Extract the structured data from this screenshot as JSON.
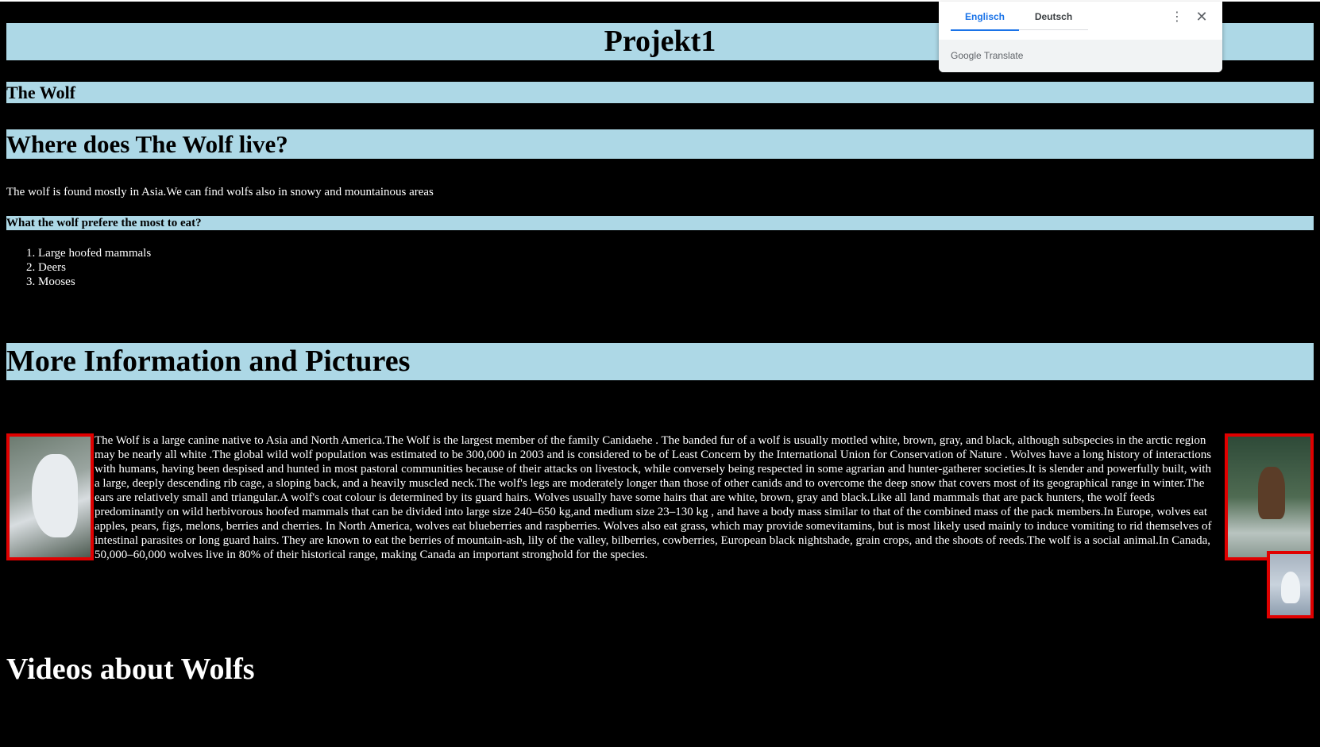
{
  "page": {
    "title": "Projekt1",
    "subtitle": "The Wolf",
    "where_heading": "Where does The Wolf live?",
    "where_text": "The wolf is found mostly in Asia.We can find wolfs also in snowy and mountainous areas",
    "eat_heading": "What the wolf prefere the most to eat?",
    "food_list": [
      "Large hoofed mammals",
      "Deers",
      "Mooses"
    ],
    "more_heading": "More Information and Pictures",
    "info_text": "The Wolf is a large canine native to Asia and North America.The Wolf is the largest member of the family Canidaehe . The banded fur of a wolf is usually mottled white, brown, gray, and black, although subspecies in the arctic region may be nearly all white .The global wild wolf population was estimated to be 300,000 in 2003 and is considered to be of Least Concern by the International Union for Conservation of Nature . Wolves have a long history of interactions with humans, having been despised and hunted in most pastoral communities because of their attacks on livestock, while conversely being respected in some agrarian and hunter-gatherer societies.It is slender and powerfully built, with a large, deeply descending rib cage, a sloping back, and a heavily muscled neck.The wolf's legs are moderately longer than those of other canids and to overcome the deep snow that covers most of its geographical range in winter.The ears are relatively small and triangular.A wolf's coat colour is determined by its guard hairs. Wolves usually have some hairs that are white, brown, gray and black.Like all land mammals that are pack hunters, the wolf feeds predominantly on wild herbivorous hoofed mammals that can be divided into large size 240–650 kg,and medium size 23–130 kg , and have a body mass similar to that of the combined mass of the pack members.In Europe, wolves eat apples, pears, figs, melons, berries and cherries. In North America, wolves eat blueberries and raspberries. Wolves also eat grass, which may provide somevitamins, but is most likely used mainly to induce vomiting to rid themselves of intestinal parasites or long guard hairs. They are known to eat the berries of mountain-ash, lily of the valley, bilberries, cowberries, European black nightshade, grain crops, and the shoots of reeds.The wolf is a social animal.In Canada, 50,000–60,000 wolves live in 80% of their historical range, making Canada an important stronghold for the species.",
    "videos_heading": "Videos about Wolfs"
  },
  "translate_popup": {
    "tab_source": "Englisch",
    "tab_target": "Deutsch",
    "menu_icon": "more-vert-icon",
    "close_icon": "close-icon",
    "brand": "Google Translate"
  },
  "colors": {
    "background": "#000000",
    "band": "#add8e6",
    "image_border": "#e00000",
    "accent": "#1a73e8"
  }
}
